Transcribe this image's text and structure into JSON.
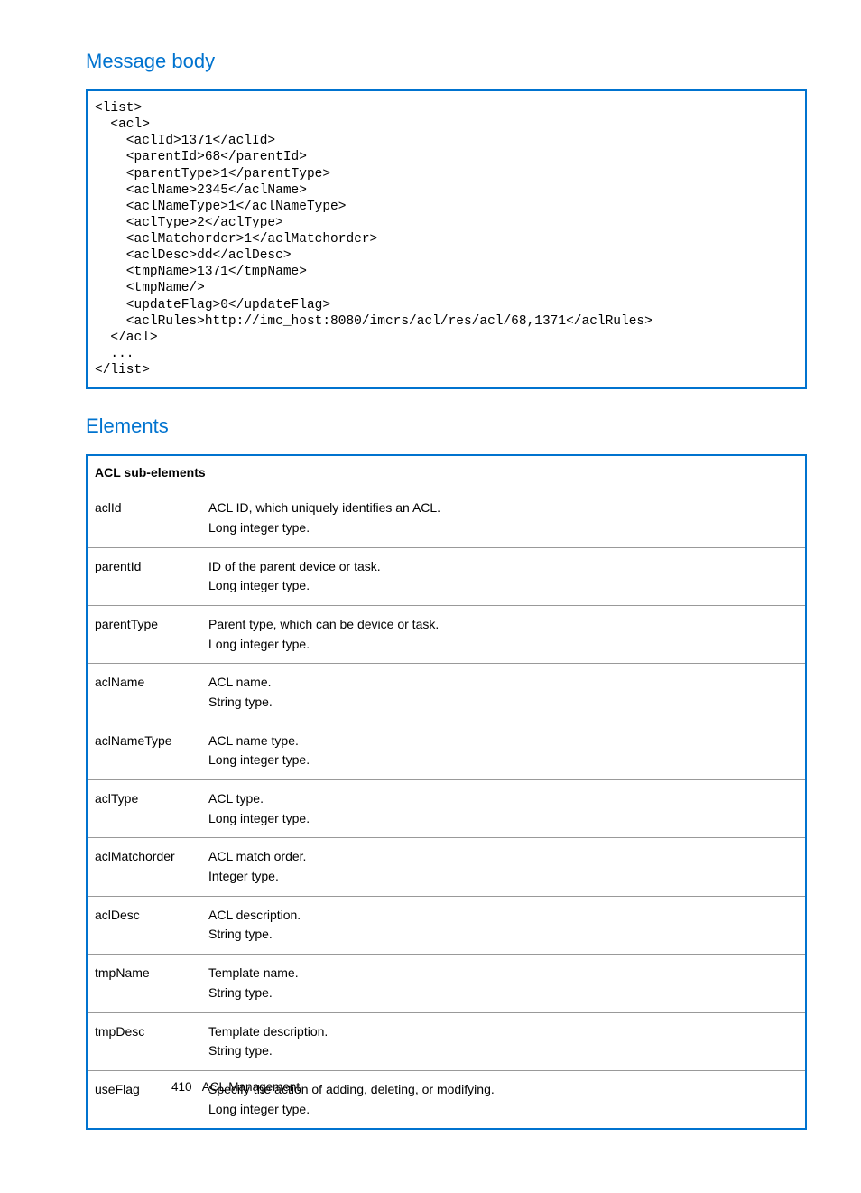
{
  "headings": {
    "message_body": "Message body",
    "elements": "Elements"
  },
  "code": "<list>\n  <acl>\n    <aclId>1371</aclId>\n    <parentId>68</parentId>\n    <parentType>1</parentType>\n    <aclName>2345</aclName>\n    <aclNameType>1</aclNameType>\n    <aclType>2</aclType>\n    <aclMatchorder>1</aclMatchorder>\n    <aclDesc>dd</aclDesc>\n    <tmpName>1371</tmpName>\n    <tmpName/>\n    <updateFlag>0</updateFlag>\n    <aclRules>http://imc_host:8080/imcrs/acl/res/acl/68,1371</aclRules>\n  </acl>\n  ...\n</list>",
  "table": {
    "header": "ACL sub-elements",
    "rows": [
      {
        "name": "aclId",
        "line1": "ACL ID, which uniquely identifies an ACL.",
        "line2": "Long integer type."
      },
      {
        "name": "parentId",
        "line1": "ID of the parent device or task.",
        "line2": "Long integer type."
      },
      {
        "name": "parentType",
        "line1": "Parent type, which can be device or task.",
        "line2": "Long integer type."
      },
      {
        "name": "aclName",
        "line1": "ACL name.",
        "line2": "String type."
      },
      {
        "name": "aclNameType",
        "line1": "ACL name type.",
        "line2": "Long integer type."
      },
      {
        "name": "aclType",
        "line1": "ACL type.",
        "line2": "Long integer type."
      },
      {
        "name": "aclMatchorder",
        "line1": "ACL match order.",
        "line2": "Integer type."
      },
      {
        "name": "aclDesc",
        "line1": "ACL description.",
        "line2": "String type."
      },
      {
        "name": "tmpName",
        "line1": "Template name.",
        "line2": "String type."
      },
      {
        "name": "tmpDesc",
        "line1": "Template description.",
        "line2": "String type."
      },
      {
        "name": "useFlag",
        "line1": "Specify the action of adding, deleting, or modifying.",
        "line2": "Long integer type."
      }
    ]
  },
  "footer": {
    "page": "410",
    "section": "ACL Management"
  }
}
